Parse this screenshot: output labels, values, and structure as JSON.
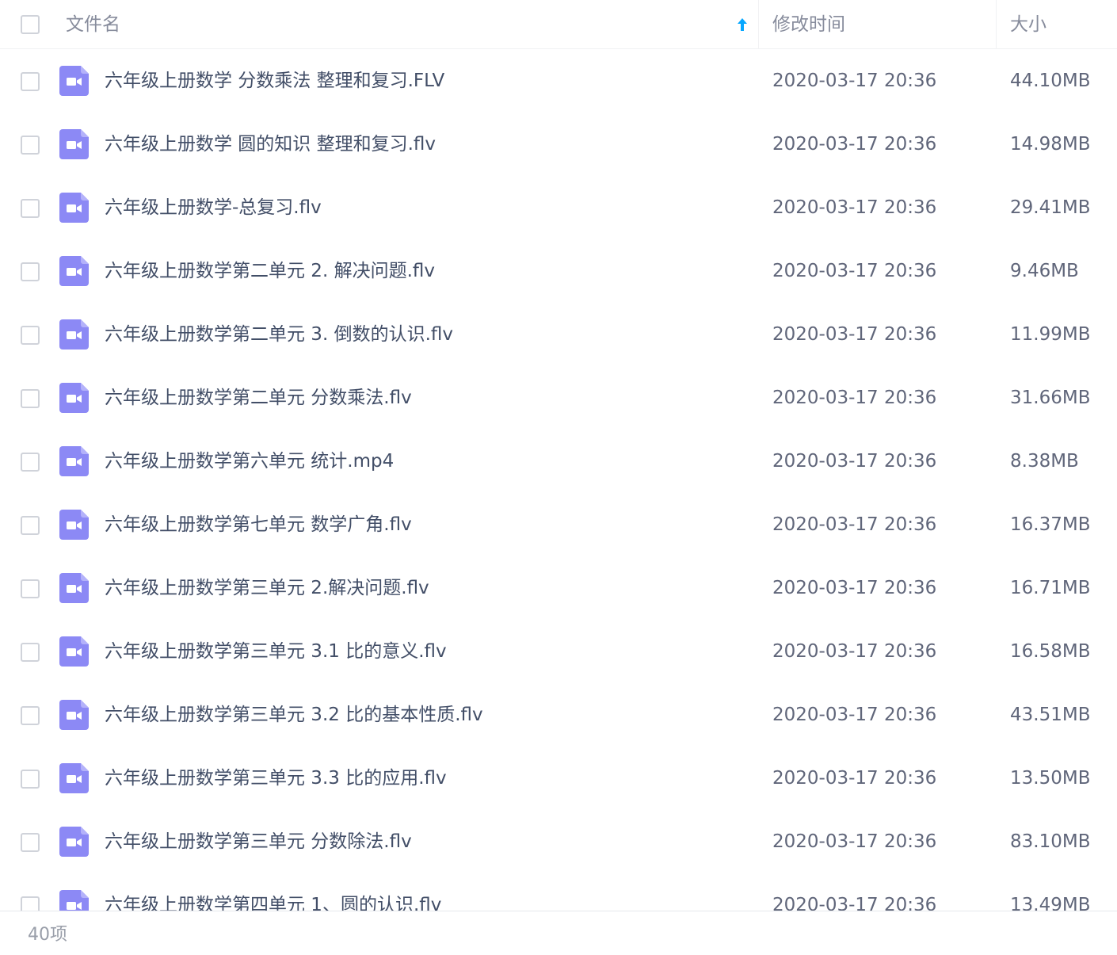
{
  "header": {
    "name_label": "文件名",
    "mtime_label": "修改时间",
    "size_label": "大小",
    "sort_icon": "arrow-up-icon",
    "accent_color": "#06a7ff"
  },
  "file_icon": {
    "name": "video-file-icon",
    "color": "#8c89f5"
  },
  "rows": [
    {
      "name": "六年级上册数学 分数乘法 整理和复习.FLV",
      "mtime": "2020-03-17 20:36",
      "size": "44.10MB"
    },
    {
      "name": "六年级上册数学 圆的知识 整理和复习.flv",
      "mtime": "2020-03-17 20:36",
      "size": "14.98MB"
    },
    {
      "name": "六年级上册数学-总复习.flv",
      "mtime": "2020-03-17 20:36",
      "size": "29.41MB"
    },
    {
      "name": "六年级上册数学第二单元 2. 解决问题.flv",
      "mtime": "2020-03-17 20:36",
      "size": "9.46MB"
    },
    {
      "name": "六年级上册数学第二单元 3. 倒数的认识.flv",
      "mtime": "2020-03-17 20:36",
      "size": "11.99MB"
    },
    {
      "name": "六年级上册数学第二单元 分数乘法.flv",
      "mtime": "2020-03-17 20:36",
      "size": "31.66MB"
    },
    {
      "name": "六年级上册数学第六单元 统计.mp4",
      "mtime": "2020-03-17 20:36",
      "size": "8.38MB"
    },
    {
      "name": "六年级上册数学第七单元 数学广角.flv",
      "mtime": "2020-03-17 20:36",
      "size": "16.37MB"
    },
    {
      "name": "六年级上册数学第三单元 2.解决问题.flv",
      "mtime": "2020-03-17 20:36",
      "size": "16.71MB"
    },
    {
      "name": "六年级上册数学第三单元 3.1 比的意义.flv",
      "mtime": "2020-03-17 20:36",
      "size": "16.58MB"
    },
    {
      "name": "六年级上册数学第三单元 3.2 比的基本性质.flv",
      "mtime": "2020-03-17 20:36",
      "size": "43.51MB"
    },
    {
      "name": "六年级上册数学第三单元 3.3 比的应用.flv",
      "mtime": "2020-03-17 20:36",
      "size": "13.50MB"
    },
    {
      "name": "六年级上册数学第三单元 分数除法.flv",
      "mtime": "2020-03-17 20:36",
      "size": "83.10MB"
    },
    {
      "name": "六年级上册数学第四单元 1、圆的认识.flv",
      "mtime": "2020-03-17 20:36",
      "size": "13.49MB"
    }
  ],
  "footer": {
    "count_label": "40项"
  }
}
